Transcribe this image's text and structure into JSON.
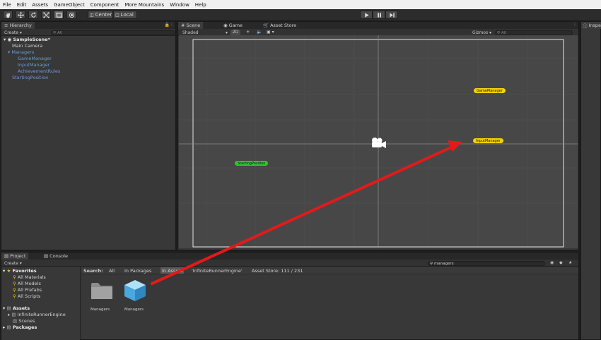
{
  "menu": [
    "File",
    "Edit",
    "Assets",
    "GameObject",
    "Component",
    "More Mountains",
    "Window",
    "Help"
  ],
  "toolbar": {
    "pivot_label": "Center",
    "space_label": "Local"
  },
  "hierarchy": {
    "tab": "Hierarchy",
    "create_label": "Create",
    "search_placeholder": "All",
    "scene_name": "SampleScene*",
    "items": [
      {
        "label": "Main Camera"
      },
      {
        "label": "Managers"
      },
      {
        "label": "GameManager"
      },
      {
        "label": "InputManager"
      },
      {
        "label": "AchievementRules"
      },
      {
        "label": "StartingPosition"
      }
    ]
  },
  "scene": {
    "tabs": [
      "Scene",
      "Game",
      "Asset Store"
    ],
    "shading_mode": "Shaded",
    "mode_2d": "2D",
    "gizmos_label": "Gizmos",
    "search_placeholder": "All",
    "labels": {
      "game_manager": "GameManager",
      "input_manager": "InputManager",
      "starting_position": "StartingPosition"
    }
  },
  "inspector": {
    "tab": "Inspe"
  },
  "project": {
    "tabs": [
      "Project",
      "Console"
    ],
    "create_label": "Create",
    "search_value": "managers",
    "search_bar": {
      "label": "Search:",
      "scopes": [
        "All",
        "In Packages",
        "In Assets",
        "'InfiniteRunnerEngine'"
      ],
      "asset_store_label": "Asset Store: 111 / 231"
    },
    "favorites": {
      "title": "Favorites",
      "items": [
        "All Materials",
        "All Models",
        "All Prefabs",
        "All Scripts"
      ]
    },
    "assets": {
      "title": "Assets",
      "items": [
        "InfiniteRunnerEngine",
        "Scenes"
      ]
    },
    "packages_title": "Packages",
    "results": [
      {
        "label": "Managers",
        "kind": "folder"
      },
      {
        "label": "Managers",
        "kind": "prefab"
      }
    ]
  },
  "colors": {
    "arrow": "#e31a1a",
    "game_label": "#f5d20c",
    "start_label": "#2ec82e"
  }
}
